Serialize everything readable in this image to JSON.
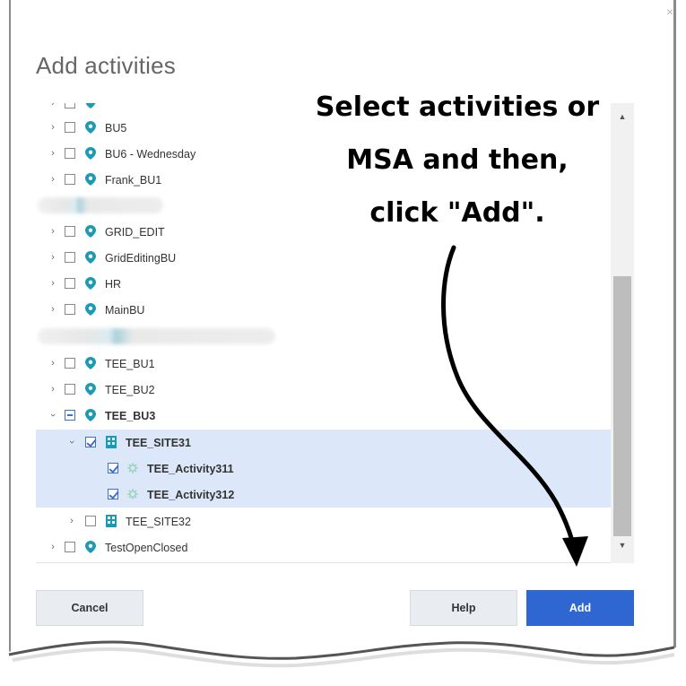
{
  "dialog": {
    "title": "Add activities",
    "close_glyph": "×"
  },
  "tree": {
    "rows": [
      {
        "label": "",
        "kind": "bu",
        "state": "unchecked",
        "note": "partially hidden row"
      },
      {
        "label": "BU5",
        "kind": "bu",
        "state": "unchecked"
      },
      {
        "label": "BU6 - Wednesday",
        "kind": "bu",
        "state": "unchecked"
      },
      {
        "label": "Frank_BU1",
        "kind": "bu",
        "state": "unchecked"
      },
      {
        "label": "GRID_EDIT",
        "kind": "bu",
        "state": "unchecked"
      },
      {
        "label": "GridEditingBU",
        "kind": "bu",
        "state": "unchecked"
      },
      {
        "label": "HR",
        "kind": "bu",
        "state": "unchecked"
      },
      {
        "label": "MainBU",
        "kind": "bu",
        "state": "unchecked"
      },
      {
        "label": "TEE_BU1",
        "kind": "bu",
        "state": "unchecked"
      },
      {
        "label": "TEE_BU2",
        "kind": "bu",
        "state": "unchecked"
      },
      {
        "label": "TEE_BU3",
        "kind": "bu",
        "state": "partial"
      },
      {
        "label": "TEE_SITE31",
        "kind": "site",
        "state": "checked"
      },
      {
        "label": "TEE_Activity311",
        "kind": "activity",
        "state": "checked"
      },
      {
        "label": "TEE_Activity312",
        "kind": "activity",
        "state": "checked"
      },
      {
        "label": "TEE_SITE32",
        "kind": "site",
        "state": "unchecked"
      },
      {
        "label": "TestOpenClosed",
        "kind": "bu",
        "state": "unchecked"
      }
    ]
  },
  "annotation": {
    "line1": "Select activities or",
    "line2": "MSA and then,",
    "line3": "click \"Add\"."
  },
  "buttons": {
    "cancel": "Cancel",
    "help": "Help",
    "add": "Add"
  },
  "colors": {
    "accent": "#2e67d1",
    "selection": "#dce8f9",
    "icon_teal": "#1b9bb3"
  },
  "icons": {
    "expand": "chevron-right-icon",
    "collapse": "chevron-down-icon",
    "bu": "map-pin-icon",
    "site": "building-icon",
    "activity": "gear-icon"
  }
}
